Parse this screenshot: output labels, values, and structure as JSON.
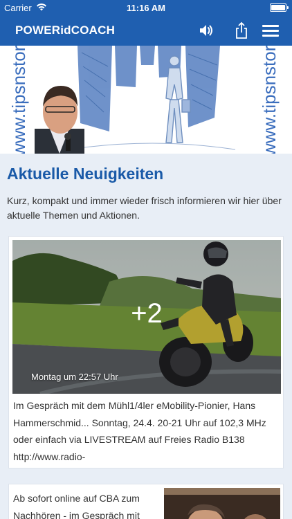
{
  "status_bar": {
    "carrier": "Carrier",
    "time": "11:16 AM"
  },
  "nav": {
    "title": "POWERidCOACH",
    "icons": [
      "speaker-icon",
      "share-icon",
      "menu-icon"
    ],
    "bar_color": "#1f5fb0"
  },
  "banner": {
    "watermark": "www.tipsnstories.com"
  },
  "section": {
    "title": "Aktuelle Neuigkeiten",
    "intro": "Kurz, kompakt und immer wieder frisch informieren wir hier über aktuelle Themen und Aktionen."
  },
  "posts": [
    {
      "photo_count": "+2",
      "timestamp": "Montag um 22:57 Uhr",
      "text": "Im Gespräch mit dem Mühl1/4ler eMobility-Pionier, Hans Hammerschmid... Sonntag, 24.4. 20-21 Uhr auf 102,3 MHz oder einfach via LIVESTREAM auf Freies Radio B138 http://www.radio-"
    },
    {
      "text": "Ab sofort online auf CBA zum Nachhören - im Gespräch mit"
    }
  ],
  "colors": {
    "accent": "#1f5fb0",
    "title": "#1a5aa8",
    "background": "#e8eef6"
  }
}
